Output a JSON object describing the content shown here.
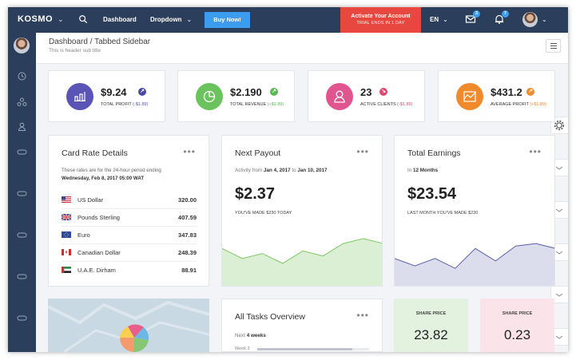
{
  "topbar": {
    "brand": "KOSMO",
    "nav_dashboard": "Dashboard",
    "nav_dropdown": "Dropdown",
    "buy_button": "Buy Now!",
    "activate_title": "Activate Your Account",
    "activate_sub": "TRIAL ENDS IN 1 DAY",
    "language": "EN",
    "mail_count": "3",
    "notification_count": "7",
    "icons": [
      "search-icon",
      "mail-icon",
      "bell-icon",
      "chevron-down-icon"
    ]
  },
  "header": {
    "title": "Dashboard / Tabbed Sidebar",
    "subtitle": "This is header sub title"
  },
  "stats": [
    {
      "value": "$9.24",
      "label": "TOTAL PROFIT",
      "delta": "(-$1.89)",
      "color": "#5b54b7",
      "arrow_color": "#4a4aa3",
      "delta_color": "#4f52b5"
    },
    {
      "value": "$2.190",
      "label": "TOTAL REVENUE",
      "delta": "(+$1.89)",
      "color": "#6ac35c",
      "arrow_color": "#5cb853",
      "delta_color": "#5cb853"
    },
    {
      "value": "23",
      "label": "ACTIVE CLIENTS",
      "delta": "(-$1.89)",
      "color": "#e0558f",
      "arrow_color": "#e2476f",
      "delta_color": "#e2476f"
    },
    {
      "value": "$431.2",
      "label": "AVERAGE PROFIT",
      "delta": "(+$1.89)",
      "color": "#f08a2b",
      "arrow_color": "#f08a2b",
      "delta_color": "#f08a2b"
    }
  ],
  "card_rate": {
    "title": "Card Rate Details",
    "intro": "These rates are for the 24-hour period ending",
    "date": "Wednesday, Feb 8, 2017 05:00 WAT",
    "rows": [
      {
        "name": "US Dollar",
        "value": "320.00",
        "flag": "us-flag-icon"
      },
      {
        "name": "Pounds Sterling",
        "value": "407.59",
        "flag": "uk-flag-icon"
      },
      {
        "name": "Euro",
        "value": "347.83",
        "flag": "eu-flag-icon"
      },
      {
        "name": "Canadian Dollar",
        "value": "248.39",
        "flag": "ca-flag-icon"
      },
      {
        "name": "U.A.E. Dirham",
        "value": "88.91",
        "flag": "ae-flag-icon"
      }
    ]
  },
  "payout": {
    "title": "Next Payout",
    "activity_prefix": "Activity from",
    "from": "Jan 4, 2017",
    "to_word": "to",
    "to": "Jan 10, 2017",
    "amount": "$2.37",
    "caption": "YOU'VE MADE $230 TODAY",
    "chart_color": "#7dc765",
    "sparkline": [
      30,
      22,
      26,
      18,
      28,
      24,
      34,
      38,
      34
    ]
  },
  "earnings": {
    "title": "Total Earnings",
    "period_prefix": "In",
    "period": "12 Months",
    "amount": "$23.54",
    "caption": "LAST MONTH YOU'VE MADE $230",
    "chart_color": "#5b61a9",
    "sparkline": [
      22,
      16,
      22,
      14,
      30,
      20,
      32,
      34,
      30
    ]
  },
  "tasks": {
    "title": "All Tasks Overview",
    "next_prefix": "Next",
    "next": "4 weeks",
    "week_label": "Week 3",
    "week_progress": 0.85
  },
  "share_prices": [
    {
      "label": "SHARE PRICE",
      "value": "23.82",
      "bg": "#e3f2df"
    },
    {
      "label": "SHARE PRICE",
      "value": "0.23",
      "bg": "#fbe3ea"
    }
  ],
  "card_menu": "•••"
}
